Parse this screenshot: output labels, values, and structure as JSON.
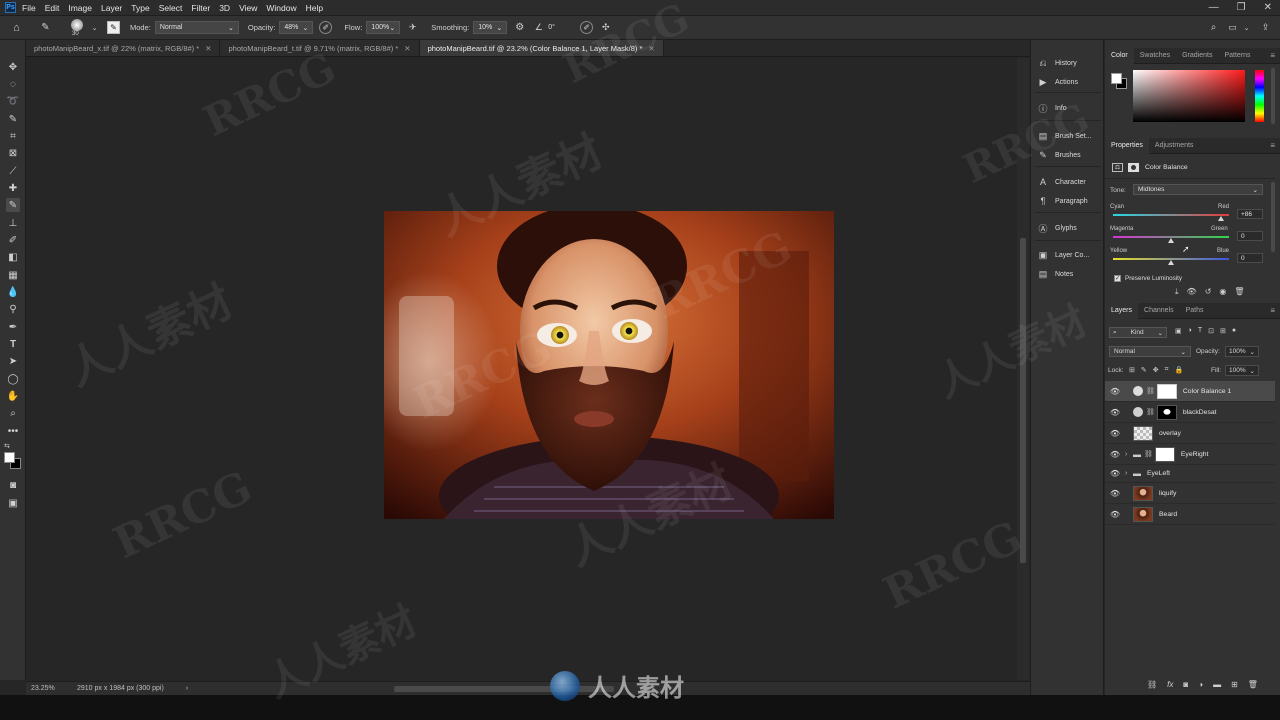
{
  "menubar": {
    "logo": "Ps",
    "items": [
      "File",
      "Edit",
      "Image",
      "Layer",
      "Type",
      "Select",
      "Filter",
      "3D",
      "View",
      "Window",
      "Help"
    ],
    "window_controls": [
      "—",
      "❐",
      "✕"
    ]
  },
  "options": {
    "brush_size": "30",
    "mode_label": "Mode:",
    "mode_value": "Normal",
    "opacity_label": "Opacity:",
    "opacity_value": "48%",
    "flow_label": "Flow:",
    "flow_value": "100%",
    "smoothing_label": "Smoothing:",
    "smoothing_value": "10%",
    "angle_value": "0°"
  },
  "tabs": [
    {
      "label": "photoManipBeard_x.tif @ 22% (matrix, RGB/8#) *"
    },
    {
      "label": "photoManipBeard_t.tif @ 9.71% (matrix, RGB/8#) *"
    },
    {
      "label": "photoManipBeard.tif @ 23.2% (Color Balance 1, Layer Mask/8) *"
    }
  ],
  "status": {
    "zoom": "23.25%",
    "doc_info": "2910 px x 1984 px (300 ppi)"
  },
  "icon_panel": {
    "items": [
      "History",
      "Actions",
      "Info",
      "Brush Set...",
      "Brushes",
      "Character",
      "Paragraph",
      "Glyphs",
      "Layer Co...",
      "Notes"
    ]
  },
  "color_panel": {
    "tabs": [
      "Color",
      "Swatches",
      "Gradients",
      "Patterns"
    ]
  },
  "properties": {
    "tabs": [
      "Properties",
      "Adjustments"
    ],
    "adjustment_name": "Color Balance",
    "tone_label": "Tone:",
    "tone_value": "Midtones",
    "sliders": [
      {
        "left": "Cyan",
        "right": "Red",
        "value": "+86",
        "position": 0.93
      },
      {
        "left": "Magenta",
        "right": "Green",
        "value": "0",
        "position": 0.5
      },
      {
        "left": "Yellow",
        "right": "Blue",
        "value": "0",
        "position": 0.5
      }
    ],
    "preserve_luminosity": "Preserve Luminosity"
  },
  "layers_panel": {
    "tabs": [
      "Layers",
      "Channels",
      "Paths"
    ],
    "kind_label": "Kind",
    "blend_mode": "Normal",
    "opacity_label": "Opacity:",
    "opacity_value": "100%",
    "lock_label": "Lock:",
    "fill_label": "Fill:",
    "fill_value": "100%",
    "layers": [
      {
        "name": "Color Balance 1",
        "type": "adjustment",
        "selected": true
      },
      {
        "name": "blackDesat",
        "type": "adjustment",
        "selected": false
      },
      {
        "name": "overlay",
        "type": "pixel-transparent",
        "selected": false
      },
      {
        "name": "EyeRight",
        "type": "group-mask",
        "selected": false
      },
      {
        "name": "EyeLeft",
        "type": "group",
        "selected": false
      },
      {
        "name": "liquify",
        "type": "photo",
        "selected": false
      },
      {
        "name": "Beard",
        "type": "photo",
        "selected": false
      }
    ]
  },
  "watermarks": {
    "rrcg": "RRCG",
    "cn": "人人素材",
    "bottom_logo": "人人素材"
  },
  "colors": {
    "accent": "#3d8ee8",
    "foreground": "#ffffff",
    "background": "#000000"
  }
}
